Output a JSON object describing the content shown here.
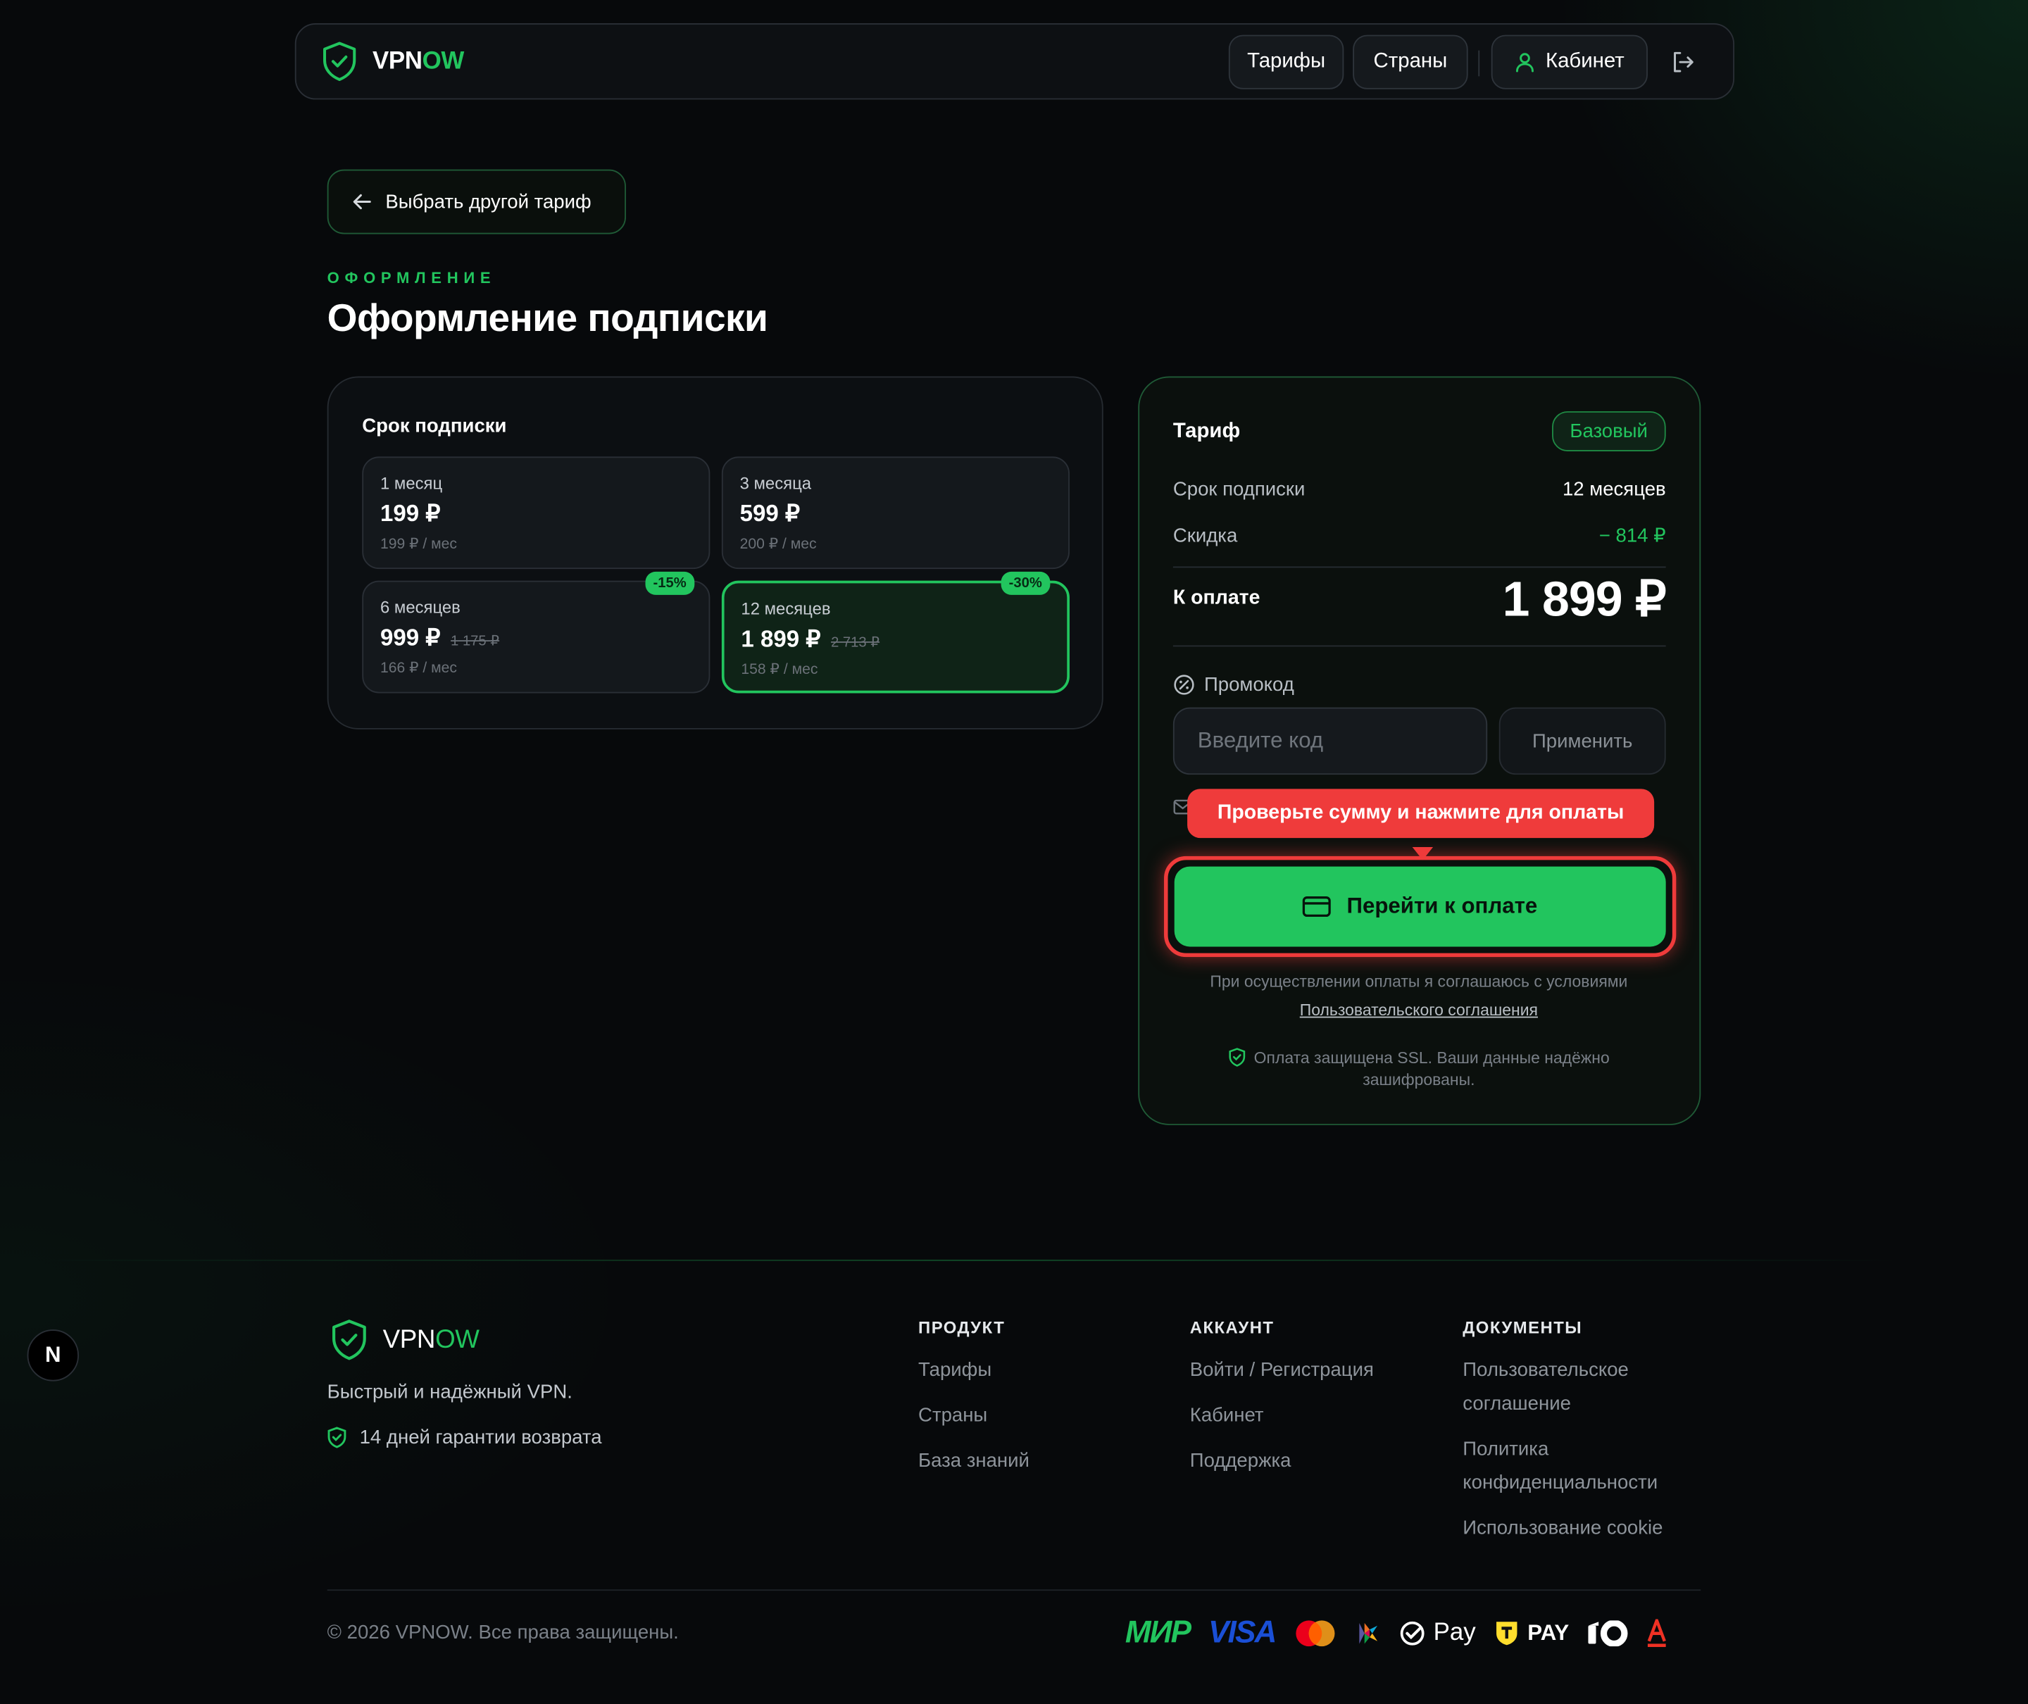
{
  "header": {
    "logo_prefix": "VPN",
    "logo_suffix": "OW",
    "nav_tariffs": "Тарифы",
    "nav_countries": "Страны",
    "nav_cabinet": "Кабинет"
  },
  "back_button": "Выбрать другой тариф",
  "eyebrow": "ОФОРМЛЕНИЕ",
  "page_title": "Оформление подписки",
  "duration": {
    "title": "Срок подписки",
    "options": [
      {
        "name": "1 месяц",
        "price": "199 ₽",
        "old": "",
        "per_month": "199 ₽ / мес",
        "badge": ""
      },
      {
        "name": "3 месяца",
        "price": "599 ₽",
        "old": "",
        "per_month": "200 ₽ / мес",
        "badge": ""
      },
      {
        "name": "6 месяцев",
        "price": "999 ₽",
        "old": "1 175 ₽",
        "per_month": "166 ₽ / мес",
        "badge": "-15%"
      },
      {
        "name": "12 месяцев",
        "price": "1 899 ₽",
        "old": "2 713 ₽",
        "per_month": "158 ₽ / мес",
        "badge": "-30%",
        "selected": true
      }
    ]
  },
  "summary": {
    "tariff_label": "Тариф",
    "tariff_value": "Базовый",
    "term_label": "Срок подписки",
    "term_value": "12 месяцев",
    "discount_label": "Скидка",
    "discount_value": "− 814 ₽",
    "total_label": "К оплате",
    "total_value": "1 899 ₽",
    "promo_label": "Промокод",
    "promo_placeholder": "Введите код",
    "apply_button": "Применить",
    "tooltip": "Проверьте сумму и нажмите для оплаты",
    "pay_button": "Перейти к оплате",
    "agree_text": "При осуществлении оплаты я соглашаюсь с условиями",
    "agree_link": "Пользовательского соглашения",
    "ssl_line1": "Оплата защищена SSL. Ваши данные надёжно",
    "ssl_line2": "зашифрованы."
  },
  "footer": {
    "logo_prefix": "VPN",
    "logo_suffix": "OW",
    "tagline": "Быстрый и надёжный VPN.",
    "guarantee": "14 дней гарантии возврата",
    "col_product": {
      "title": "ПРОДУКТ",
      "links": [
        "Тарифы",
        "Страны",
        "База знаний"
      ]
    },
    "col_account": {
      "title": "АККАУНТ",
      "links": [
        "Войти / Регистрация",
        "Кабинет",
        "Поддержка"
      ]
    },
    "col_docs": {
      "title": "ДОКУМЕНТЫ",
      "links": [
        "Пользовательское",
        "соглашение",
        "Политика",
        "конфиденциальности",
        "Использование cookie"
      ]
    },
    "copyright": "© 2026 VPNOW. Все права защищены.",
    "pay_mir": "МИР",
    "pay_visa": "VISA",
    "pay_sber": "Pay",
    "pay_t": "PAY"
  },
  "floating_button": "N",
  "colors": {
    "accent": "#22c55e",
    "alert": "#ef3b3b",
    "background": "#07090b"
  }
}
